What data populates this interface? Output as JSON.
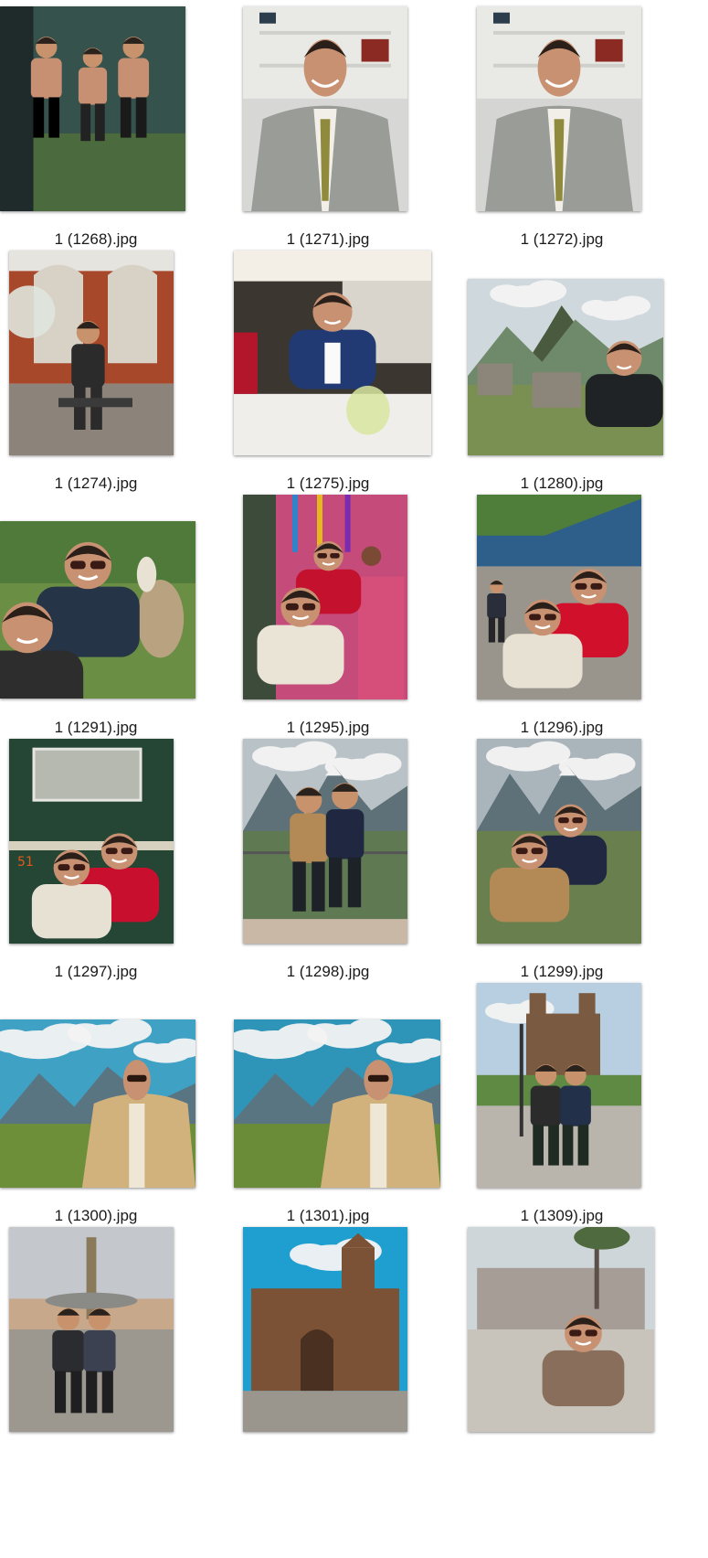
{
  "view": "large-icons",
  "files": [
    {
      "name": "1 (1268).jpg",
      "scene": "gym-trio",
      "sky": "#35524c",
      "ground": "#4b6b3e",
      "accent": "#7fb7d8"
    },
    {
      "name": "1 (1271).jpg",
      "scene": "suit-portrait",
      "sky": "#d7d8d6",
      "ground": "#bdb9b2",
      "accent": "#9a9c98"
    },
    {
      "name": "1 (1272).jpg",
      "scene": "suit-portrait",
      "sky": "#d5d6d4",
      "ground": "#bbb7b0",
      "accent": "#9a9c98"
    },
    {
      "name": "1 (1274).jpg",
      "scene": "courtyard-seated",
      "sky": "#e6e4de",
      "ground": "#a8482a",
      "accent": "#2b2b2b"
    },
    {
      "name": "1 (1275).jpg",
      "scene": "restaurant",
      "sky": "#3b3630",
      "ground": "#f0eeea",
      "accent": "#213a73"
    },
    {
      "name": "1 (1280).jpg",
      "scene": "machu-picchu",
      "sky": "#cfd8dc",
      "ground": "#7a8f52",
      "accent": "#1f2326"
    },
    {
      "name": "1 (1291).jpg",
      "scene": "llama-selfie",
      "sky": "#4f7a3a",
      "ground": "#6b8e45",
      "accent": "#263447"
    },
    {
      "name": "1 (1295).jpg",
      "scene": "market-selfie",
      "sky": "#c54b7a",
      "ground": "#8c8c86",
      "accent": "#c4112d"
    },
    {
      "name": "1 (1296).jpg",
      "scene": "train-platform",
      "sky": "#2d5f8a",
      "ground": "#9a958c",
      "accent": "#d1102c"
    },
    {
      "name": "1 (1297).jpg",
      "scene": "train-sign",
      "sky": "#254535",
      "ground": "#254535",
      "accent": "#c8102e"
    },
    {
      "name": "1 (1298).jpg",
      "scene": "viewpoint-duo",
      "sky": "#b9c2c6",
      "ground": "#5f7a52",
      "accent": "#b38a55"
    },
    {
      "name": "1 (1299).jpg",
      "scene": "viewpoint-selfie",
      "sky": "#aab5bb",
      "ground": "#6a7f4e",
      "accent": "#b38a55"
    },
    {
      "name": "1 (1300).jpg",
      "scene": "valley-jacket",
      "sky": "#3fa1c4",
      "ground": "#6d8f3a",
      "accent": "#d2b27c"
    },
    {
      "name": "1 (1301).jpg",
      "scene": "valley-jacket",
      "sky": "#2f95b8",
      "ground": "#6a8b38",
      "accent": "#d2b27c"
    },
    {
      "name": "1 (1309).jpg",
      "scene": "plaza-cathedral",
      "sky": "#b7cfe0",
      "ground": "#b9b4ac",
      "accent": "#22304a"
    },
    {
      "name": "",
      "scene": "fountain-plaza",
      "sky": "#c4c8cc",
      "ground": "#9c9890",
      "accent": "#2a2c30"
    },
    {
      "name": "",
      "scene": "cathedral",
      "sky": "#1f9fcf",
      "ground": "#8b6a4a",
      "accent": "#7b5236"
    },
    {
      "name": "",
      "scene": "blur-palace",
      "sky": "#cfd6da",
      "ground": "#c9c4bb",
      "accent": "#8a6e5c"
    }
  ]
}
